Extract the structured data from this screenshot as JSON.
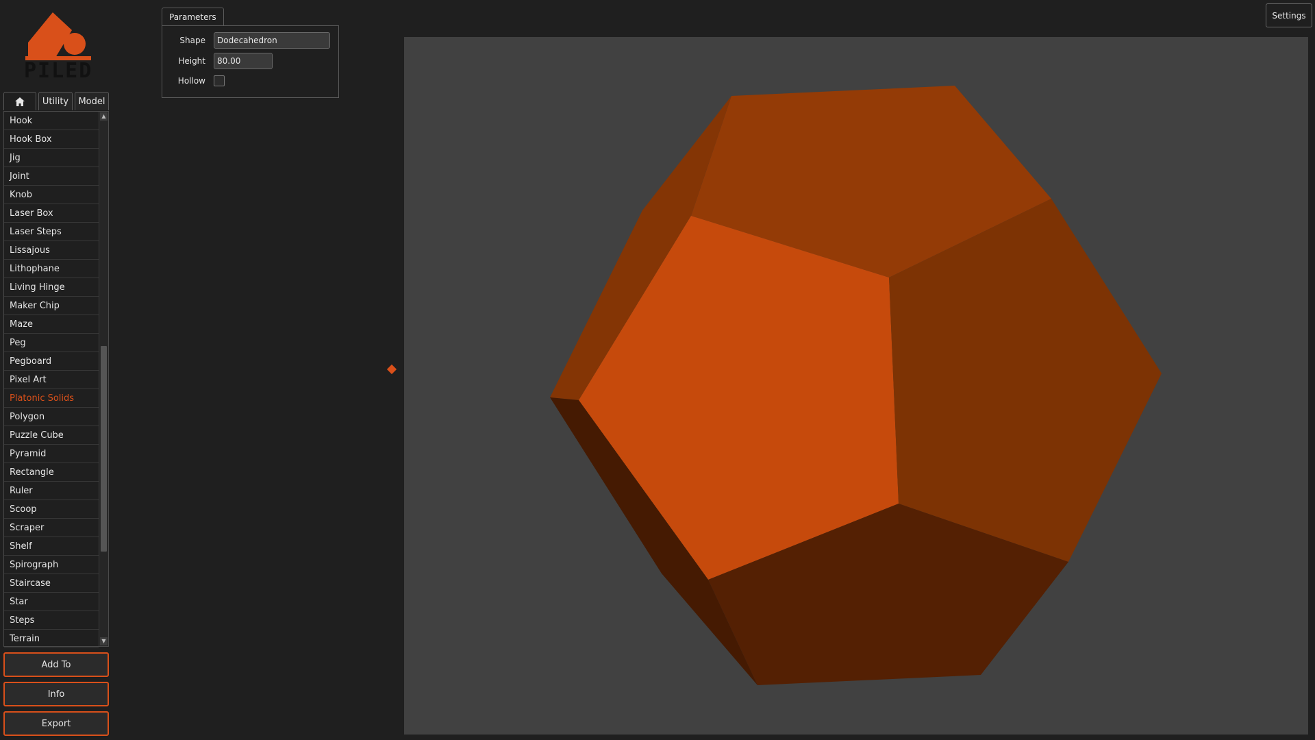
{
  "app": {
    "logo_text": "PILED"
  },
  "tabs": [
    {
      "label": "",
      "icon": "home-icon"
    },
    {
      "label": "Utility"
    },
    {
      "label": "Model"
    }
  ],
  "list": {
    "selected": "Platonic Solids",
    "items": [
      "Hook",
      "Hook Box",
      "Jig",
      "Joint",
      "Knob",
      "Laser Box",
      "Laser Steps",
      "Lissajous",
      "Lithophane",
      "Living Hinge",
      "Maker Chip",
      "Maze",
      "Peg",
      "Pegboard",
      "Pixel Art",
      "Platonic Solids",
      "Polygon",
      "Puzzle Cube",
      "Pyramid",
      "Rectangle",
      "Ruler",
      "Scoop",
      "Scraper",
      "Shelf",
      "Spirograph",
      "Staircase",
      "Star",
      "Steps",
      "Terrain"
    ]
  },
  "buttons": {
    "add_to": "Add To",
    "info": "Info",
    "export": "Export",
    "settings": "Settings"
  },
  "parameters": {
    "tab_label": "Parameters",
    "shape_label": "Shape",
    "shape_value": "Dodecahedron",
    "height_label": "Height",
    "height_value": "80.00",
    "hollow_label": "Hollow",
    "hollow_checked": false
  },
  "colors": {
    "accent": "#d9501a",
    "background": "#1f1f1f",
    "viewport": "#414141",
    "face_front": "#c64a0c",
    "face_top": "#943b06",
    "face_right": "#7d3304",
    "face_left": "#843505",
    "face_bottom": "#542003",
    "face_bottom_left": "#451a02"
  }
}
